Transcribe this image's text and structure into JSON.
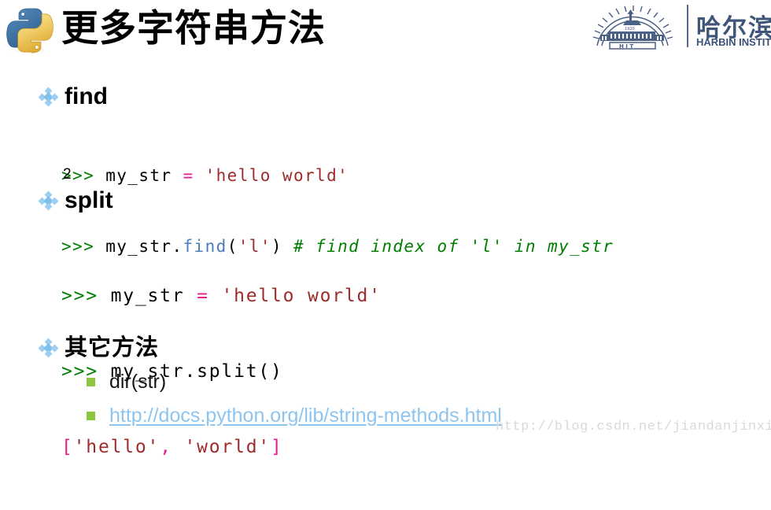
{
  "slide": {
    "title": "更多字符串方法",
    "background_color": "#ffffff"
  },
  "brand": {
    "python_logo_name": "python-logo",
    "hit_logo_cjk": "哈尔滨",
    "hit_logo_en": "HARBIN INSTITU",
    "hit_color": "#3f5678"
  },
  "sections": [
    {
      "heading": "find",
      "code_lines": [
        [
          {
            "t": ">>> ",
            "c": "prompt"
          },
          {
            "t": "my_str ",
            "c": "name"
          },
          {
            "t": "=",
            "c": "op"
          },
          {
            "t": " ",
            "c": "name"
          },
          {
            "t": "'hello world'",
            "c": "str"
          }
        ],
        [
          {
            "t": ">>> ",
            "c": "prompt"
          },
          {
            "t": "my_str.",
            "c": "name"
          },
          {
            "t": "find",
            "c": "method"
          },
          {
            "t": "(",
            "c": "name"
          },
          {
            "t": "'l'",
            "c": "str"
          },
          {
            "t": ") ",
            "c": "name"
          },
          {
            "t": "# find index of 'l' in my_str",
            "c": "comment"
          }
        ]
      ],
      "output": "2"
    },
    {
      "heading": "split",
      "code_lines": [
        [
          {
            "t": ">>> ",
            "c": "prompt"
          },
          {
            "t": "my_str ",
            "c": "name"
          },
          {
            "t": "=",
            "c": "op"
          },
          {
            "t": " ",
            "c": "name"
          },
          {
            "t": "'hello world'",
            "c": "str"
          }
        ],
        [
          {
            "t": ">>> ",
            "c": "prompt"
          },
          {
            "t": "my_str.split()",
            "c": "name"
          }
        ],
        [
          {
            "t": "[",
            "c": "punct"
          },
          {
            "t": "'hello'",
            "c": "str"
          },
          {
            "t": ",",
            "c": "punct"
          },
          {
            "t": " ",
            "c": "name"
          },
          {
            "t": "'world'",
            "c": "str"
          },
          {
            "t": "]",
            "c": "punct"
          }
        ]
      ],
      "output": ""
    },
    {
      "heading": "其它方法",
      "sub_items": [
        {
          "label": "dir(str)",
          "is_link": false
        },
        {
          "label": "http://docs.python.org/lib/string-methods.html",
          "is_link": true
        }
      ]
    }
  ],
  "watermark": "http://blog.csdn.net/jiandanjinxin",
  "colors": {
    "prompt_green": "#008000",
    "operator_pink": "#ec1c8c",
    "string_red": "#9e2b2b",
    "method_blue": "#4a7ebb",
    "comment_green": "#008000",
    "bullet_blue": "#7fc0ec",
    "bullet_green": "#8cc63e",
    "link_blue": "#8ec5ef"
  }
}
